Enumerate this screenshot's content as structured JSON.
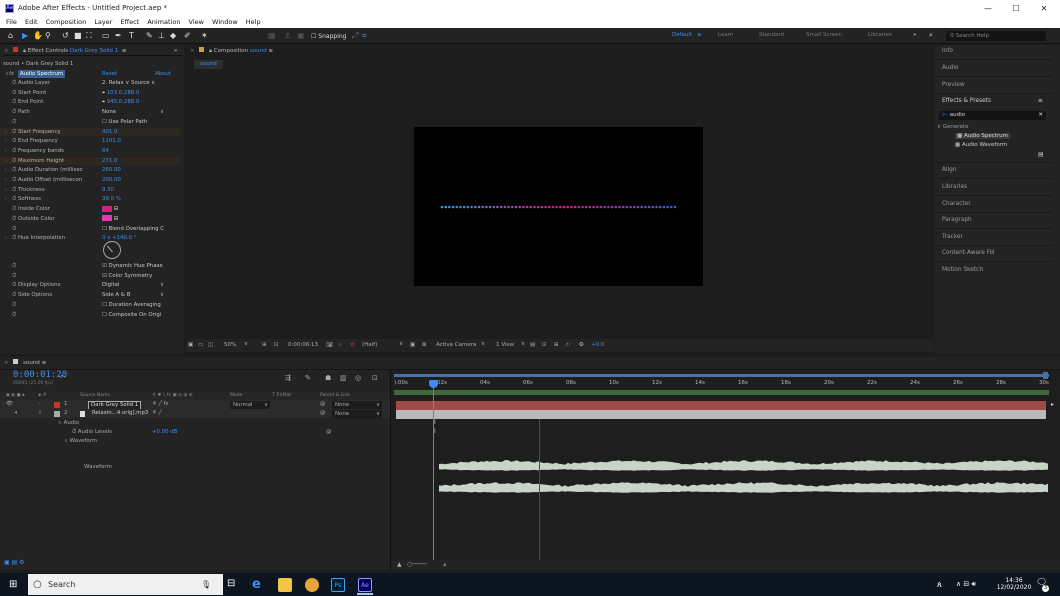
{
  "window": {
    "app_icon": "Ae",
    "title": "Adobe After Effects - Untitled Project.aep *",
    "minimize": "—",
    "maximize": "☐",
    "close": "✕"
  },
  "menu": [
    "File",
    "Edit",
    "Composition",
    "Layer",
    "Effect",
    "Animation",
    "View",
    "Window",
    "Help"
  ],
  "toolbar": {
    "snapping": "Snapping",
    "workspaces": [
      "Default",
      "Learn",
      "Standard",
      "Small Screen",
      "Libraries"
    ],
    "more": "»",
    "search_placeholder": "Search Help"
  },
  "effect_controls": {
    "tab_label": "Effect Controls",
    "tab_layer": "Dark Grey Solid 1",
    "breadcrumb": "sound • Dark Grey Solid 1",
    "effect_name": "Audio Spectrum",
    "reset": "Reset",
    "about": "About",
    "rows": [
      {
        "label": "Audio Layer",
        "value": "2. Relax ∨   Source ∨",
        "white": true
      },
      {
        "label": "Start Point",
        "value": "103.0,288.0",
        "point": true
      },
      {
        "label": "End Point",
        "value": "945.0,288.0",
        "point": true
      },
      {
        "label": "Path",
        "value": "None",
        "white": true
      },
      {
        "label": "",
        "value": "Use Polar Path",
        "check": true,
        "checked": false
      },
      {
        "label": "Start Frequency",
        "value": "401.0",
        "hl": true
      },
      {
        "label": "End Frequency",
        "value": "1101.0"
      },
      {
        "label": "Frequency bands",
        "value": "64"
      },
      {
        "label": "Maximum Height",
        "value": "271.0",
        "hl": true
      },
      {
        "label": "Audio Duration (millisec",
        "value": "260.00"
      },
      {
        "label": "Audio Offset (millisecon",
        "value": "200.00"
      },
      {
        "label": "Thickness",
        "value": "9.30"
      },
      {
        "label": "Softness",
        "value": "39.0 %"
      },
      {
        "label": "Inside Color",
        "value": "",
        "swatch": "#e0197d"
      },
      {
        "label": "Outside Color",
        "value": "",
        "swatch": "#e23ab0"
      },
      {
        "label": "",
        "value": "Blend Overlapping C",
        "check": true,
        "checked": false
      },
      {
        "label": "Hue Interpolation",
        "value": "0 x +140.0 °"
      }
    ],
    "rows2": [
      {
        "label": "",
        "value": "Dynamic Hue Phase",
        "check": true,
        "checked": true
      },
      {
        "label": "",
        "value": "Color Symmetry",
        "check": true,
        "checked": true
      },
      {
        "label": "Display Options",
        "value": "Digital",
        "white": true
      },
      {
        "label": "Side Options",
        "value": "Side A & B",
        "white": true
      },
      {
        "label": "",
        "value": "Duration Averaging",
        "check": true,
        "checked": false
      },
      {
        "label": "",
        "value": "Composite On Origi",
        "check": true,
        "checked": false
      }
    ]
  },
  "composition": {
    "tab_label": "Composition",
    "tab_name": "sound",
    "subtab": "sound",
    "zoom": "50%",
    "timecode": "0:00:06:13",
    "resolution": "(Half)",
    "camera": "Active Camera",
    "views": "1 View",
    "exposure": "+0.0"
  },
  "right_panel": {
    "items": [
      "Info",
      "Audio",
      "Preview",
      "Effects & Presets"
    ],
    "search_value": "audio",
    "category": "Generate",
    "results": [
      "Audio Spectrum",
      "Audio Waveform"
    ],
    "items2": [
      "Align",
      "Libraries",
      "Character",
      "Paragraph",
      "Tracker",
      "Content-Aware Fill",
      "Motion Sketch"
    ]
  },
  "timeline": {
    "tab": "sound",
    "timecode": "0:00:01:20",
    "frames": "00045 (25.00 fps)",
    "columns": {
      "source": "Source Name",
      "mode": "Mode",
      "trkmat": "T  TrkMat",
      "parent": "Parent & Link"
    },
    "layers": [
      {
        "num": "1",
        "name": "Dark Grey Solid 1",
        "mode": "Normal",
        "parent": "None"
      },
      {
        "num": "2",
        "name": "Relaxin...4.orig].mp3",
        "mode": "",
        "parent": "None"
      }
    ],
    "audio_group": "Audio",
    "audio_levels": "Audio Levels",
    "audio_levels_value": "+0.00 dB",
    "waveform_group": "Waveform",
    "waveform_label": "Waveform",
    "ruler": [
      "):00s",
      "02s",
      "04s",
      "06s",
      "08s",
      "10s",
      "12s",
      "14s",
      "16s",
      "18s",
      "20s",
      "22s",
      "24s",
      "26s",
      "28s",
      "30s"
    ]
  },
  "taskbar": {
    "search": "Search",
    "time": "14:36",
    "date": "12/02/2020",
    "notifications": "3"
  },
  "colors": {
    "accent": "#3b8ef5",
    "layer_red": "#a04a4a",
    "waveform": "#c8d4c8",
    "spectrum_start": "#2b9fe0",
    "spectrum_mid": "#e0197d",
    "spectrum_end": "#3b5bd8"
  }
}
